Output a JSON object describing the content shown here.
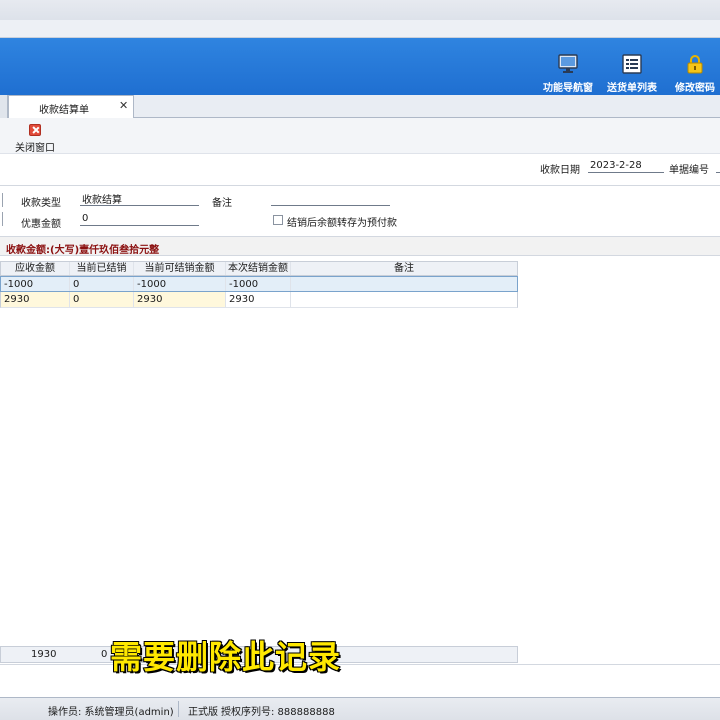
{
  "nav": {
    "items": [
      {
        "label": "功能导航窗",
        "icon": "monitor-icon"
      },
      {
        "label": "送货单列表",
        "icon": "list-icon"
      },
      {
        "label": "修改密码",
        "icon": "lock-icon"
      }
    ]
  },
  "tab": {
    "label": "收款结算单"
  },
  "toolbar": {
    "close_label": "关闭窗口"
  },
  "header": {
    "date_label": "收款日期",
    "date_value": "2023-2-28",
    "doc_no_label": "单据编号",
    "type_label": "收款类型",
    "type_value": "收款结算",
    "remark_label": "备注",
    "remark_value": "",
    "discount_label": "优惠金额",
    "discount_value": "0",
    "prepay_label": "结销后余额转存为预付款"
  },
  "amount": {
    "text": "收款金额:(大写)壹仟玖佰叁拾元整"
  },
  "grid": {
    "columns": [
      "应收金额",
      "当前已结销",
      "当前可结销金额",
      "本次结销金额",
      "备注"
    ],
    "rows": [
      [
        "-1000",
        "0",
        "-1000",
        "-1000",
        ""
      ],
      [
        "2930",
        "0",
        "2930",
        "2930",
        ""
      ]
    ],
    "footer": {
      "total": "1930",
      "second": "0"
    }
  },
  "subtitle": "需要删除此记录",
  "status": {
    "operator": "操作员: 系统管理员(admin)",
    "edition": "正式版",
    "license": "授权序列号: 888888888"
  },
  "colors": {
    "banner": "#1f6fd1",
    "amount_text": "#8b1010",
    "subtitle": "#ffe800"
  }
}
